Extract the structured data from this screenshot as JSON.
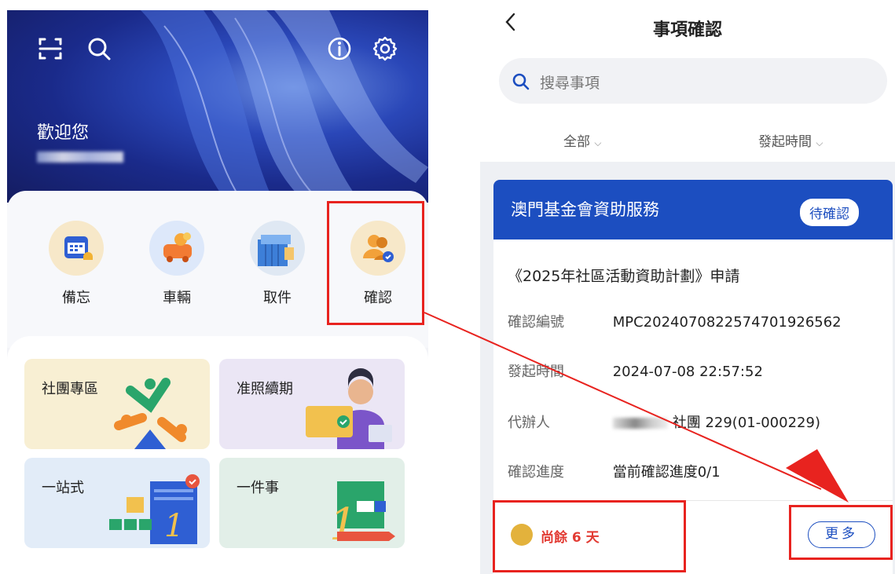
{
  "left_app": {
    "hero": {
      "welcome": "歡迎您"
    },
    "header_icons": [
      "scan-icon",
      "search-icon",
      "info-icon",
      "settings-icon"
    ],
    "quick_actions": [
      {
        "label": "備忘",
        "icon": "calendar-icon"
      },
      {
        "label": "車輛",
        "icon": "car-icon"
      },
      {
        "label": "取件",
        "icon": "parcel-icon"
      },
      {
        "label": "確認",
        "icon": "confirm-users-icon"
      }
    ],
    "tiles": [
      {
        "title": "社團專區"
      },
      {
        "title": "准照續期"
      },
      {
        "title": "一站式"
      },
      {
        "title": "一件事"
      }
    ]
  },
  "right_app": {
    "title": "事項確認",
    "search": {
      "placeholder": "搜尋事項"
    },
    "filters": {
      "category": "全部",
      "sort": "發起時間"
    },
    "card": {
      "org": "澳門基金會資助服務",
      "status": "待確認",
      "subject": "《2025年社區活動資助計劃》申請",
      "fields": [
        {
          "key": "確認編號",
          "value": "MPC20240708225747019265​62"
        },
        {
          "key": "發起時間",
          "value": "2024-07-08 22:57:52"
        },
        {
          "key": "代辦人",
          "value": "社團 229(01-000229)"
        },
        {
          "key": "確認進度",
          "value": "當前確認進度0/1"
        }
      ],
      "remaining": "尚餘 6 天",
      "more": "更多"
    }
  },
  "colors": {
    "brand_blue": "#1c4ec0",
    "highlight_red": "#e8231f",
    "remaining_red": "#e23b33",
    "dot_gold": "#e3b23c"
  }
}
